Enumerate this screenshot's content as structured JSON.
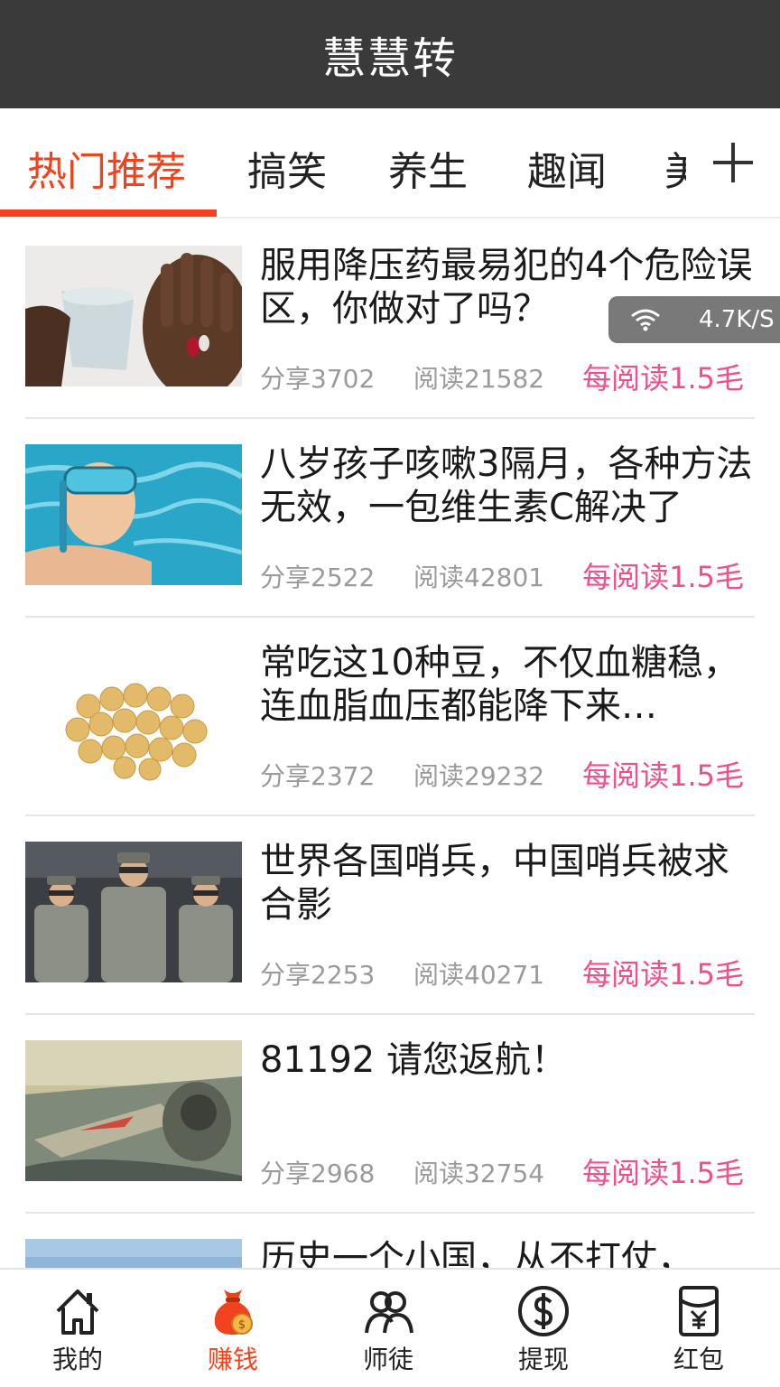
{
  "header": {
    "title": "慧慧转"
  },
  "tabs": [
    {
      "label": "热门推荐",
      "active": true
    },
    {
      "label": "搞笑"
    },
    {
      "label": "养生"
    },
    {
      "label": "趣闻"
    },
    {
      "label": "美"
    }
  ],
  "add_tab_icon": "plus-icon",
  "network_badge": {
    "icon": "wifi-icon",
    "speed": "4.7K/S"
  },
  "articles": [
    {
      "title": "服用降压药最易犯的4个危险误区，你做对了吗？",
      "share": "分享3702",
      "read": "阅读21582",
      "reward": "每阅读1.5毛"
    },
    {
      "title": "八岁孩子咳嗽3隔月，各种方法无效，一包维生素C解决了",
      "share": "分享2522",
      "read": "阅读42801",
      "reward": "每阅读1.5毛"
    },
    {
      "title": "常吃这10种豆，不仅血糖稳，连血脂血压都能降下来…",
      "share": "分享2372",
      "read": "阅读29232",
      "reward": "每阅读1.5毛"
    },
    {
      "title": "世界各国哨兵，中国哨兵被求合影",
      "share": "分享2253",
      "read": "阅读40271",
      "reward": "每阅读1.5毛"
    },
    {
      "title": "81192 请您返航！",
      "share": "分享2968",
      "read": "阅读32754",
      "reward": "每阅读1.5毛"
    },
    {
      "title": "历史一个小国，从不打仗，",
      "share": "",
      "read": "",
      "reward": ""
    }
  ],
  "bottom_nav": [
    {
      "label": "我的",
      "icon": "home-icon"
    },
    {
      "label": "赚钱",
      "icon": "money-bag-icon",
      "active": true
    },
    {
      "label": "师徒",
      "icon": "users-icon"
    },
    {
      "label": "提现",
      "icon": "dollar-coin-icon"
    },
    {
      "label": "红包",
      "icon": "red-envelope-icon"
    }
  ],
  "colors": {
    "header_bg": "#3a3a3a",
    "accent": "#f0421c",
    "reward": "#ee4f8d",
    "meta": "#9a9a9a"
  }
}
